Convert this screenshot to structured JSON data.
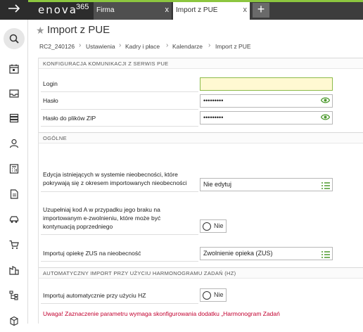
{
  "topbar": {
    "menu_icon": "arrow-right-icon",
    "logo_text": "enova",
    "logo_number": "365",
    "tabs": [
      {
        "label": "Firma",
        "close": "x"
      },
      {
        "label": "Import z PUE",
        "close": "x"
      }
    ],
    "new_tab": "+"
  },
  "sidebar": {
    "items": [
      "search-icon",
      "calendar-icon",
      "inbox-icon",
      "database-icon",
      "people-icon",
      "calculator-icon",
      "document-icon",
      "car-icon",
      "cart-icon",
      "building-icon",
      "tree-icon",
      "box-icon"
    ]
  },
  "header": {
    "title": "Import z PUE"
  },
  "breadcrumb": [
    "RC2_240126",
    "Ustawienia",
    "Kadry i płace",
    "Kalendarze",
    "Import z PUE"
  ],
  "sections": {
    "komunikacja": {
      "title": "KONFIGURACJA KOMUNIKACJI Z SERWIS PUE",
      "login_label": "Login",
      "login_value": "",
      "haslo_label": "Hasło",
      "haslo_value": "•••••••••",
      "zip_label": "Hasło do plików ZIP",
      "zip_value": "•••••••••"
    },
    "ogolne": {
      "title": "OGÓLNE",
      "edycja_label_1": "Edycja istniejących w systemie nieobecności, które",
      "edycja_label_2": "pokrywają się z okresem importowanych nieobecności",
      "edycja_value": "Nie edytuj",
      "kodA_label_1": "Uzupełniaj kod A w przypadku jego braku na",
      "kodA_label_2": "importowanym e-zwolnieniu, które może być",
      "kodA_label_3": "kontynuacją poprzedniego",
      "kodA_value": "Nie",
      "opieka_label": "Importuj opiekę ZUS na nieobecność",
      "opieka_value": "Zwolnienie opieka (ZUS)"
    },
    "automatyczny": {
      "title": "AUTOMATYCZNY IMPORT PRZY UŻYCIU HARMONOGRAMU ZADAŃ (HZ)",
      "hz_label": "Importuj automatycznie przy użyciu HZ",
      "hz_value": "Nie",
      "warning": "Uwaga! Zaznaczenie parametru wymaga skonfigurowania dodatku „Harmonogram Zadań"
    }
  },
  "colors": {
    "accent": "#8cc63f",
    "warning": "#c2002f",
    "topbar": "#3d3d3d"
  }
}
